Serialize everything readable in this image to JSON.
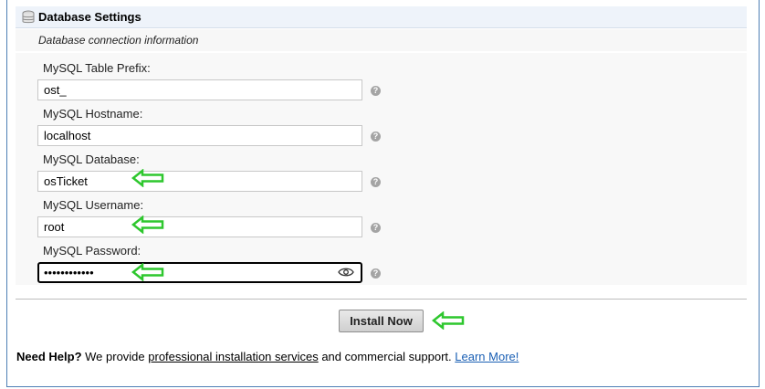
{
  "section": {
    "title": "Database Settings",
    "subtitle": "Database connection information",
    "icon": "database-icon"
  },
  "fields": [
    {
      "label": "MySQL Table Prefix:",
      "value": "ost_"
    },
    {
      "label": "MySQL Hostname:",
      "value": "localhost"
    },
    {
      "label": "MySQL Database:",
      "value": "osTicket"
    },
    {
      "label": "MySQL Username:",
      "value": "root"
    },
    {
      "label": "MySQL Password:",
      "value": "••••••••••••"
    }
  ],
  "help_icon_glyph": "?",
  "install_button": "Install Now",
  "help": {
    "lead": "Need Help?",
    "text1": " We provide ",
    "link1": "professional installation services",
    "text2": " and commercial support. ",
    "link2": "Learn More!"
  },
  "colors": {
    "arrow": "#2ec72e",
    "frame_border": "#4e7fb5",
    "link": "#1a5fb4"
  }
}
